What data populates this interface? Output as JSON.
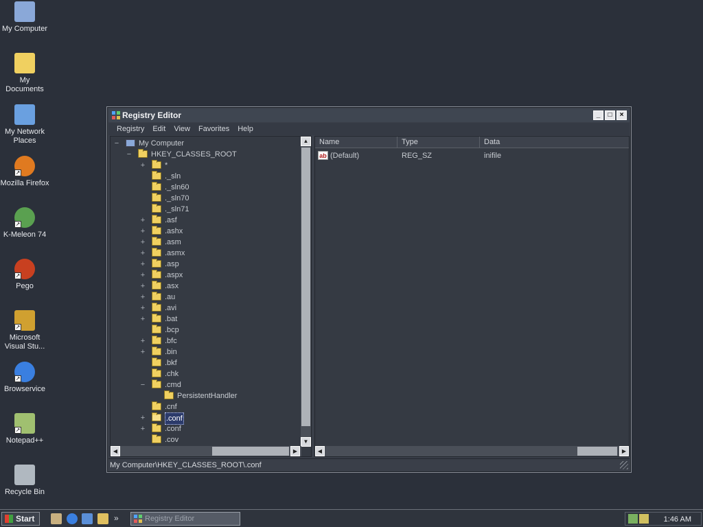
{
  "desktop": {
    "icons": [
      {
        "label": "My Computer",
        "icon": "computer-icon"
      },
      {
        "label": "My Documents",
        "icon": "documents-folder-icon"
      },
      {
        "label": "My Network Places",
        "icon": "network-icon"
      },
      {
        "label": "Mozilla Firefox",
        "icon": "firefox-icon"
      },
      {
        "label": "K-Meleon 74",
        "icon": "kmeleon-icon"
      },
      {
        "label": "Pego",
        "icon": "pego-icon"
      },
      {
        "label": "Microsoft Visual Stu...",
        "icon": "visual-studio-icon"
      },
      {
        "label": "Browservice",
        "icon": "ie-icon"
      },
      {
        "label": "Notepad++",
        "icon": "notepadpp-icon"
      },
      {
        "label": "Recycle Bin",
        "icon": "recycle-bin-icon"
      }
    ]
  },
  "window": {
    "title": "Registry Editor",
    "controls": {
      "minimize": "_",
      "maximize": "□",
      "close": "×"
    },
    "menu": [
      "Registry",
      "Edit",
      "View",
      "Favorites",
      "Help"
    ],
    "tree": [
      {
        "label": "My Computer",
        "expander": "−",
        "level": 0,
        "kind": "computer"
      },
      {
        "label": "HKEY_CLASSES_ROOT",
        "expander": "−",
        "level": 1,
        "kind": "folder"
      },
      {
        "label": "*",
        "expander": "+",
        "level": 2,
        "kind": "folder"
      },
      {
        "label": "._sln",
        "expander": "",
        "level": 2,
        "kind": "folder"
      },
      {
        "label": "._sln60",
        "expander": "",
        "level": 2,
        "kind": "folder"
      },
      {
        "label": "._sln70",
        "expander": "",
        "level": 2,
        "kind": "folder"
      },
      {
        "label": "._sln71",
        "expander": "",
        "level": 2,
        "kind": "folder"
      },
      {
        "label": ".asf",
        "expander": "+",
        "level": 2,
        "kind": "folder"
      },
      {
        "label": ".ashx",
        "expander": "+",
        "level": 2,
        "kind": "folder"
      },
      {
        "label": ".asm",
        "expander": "+",
        "level": 2,
        "kind": "folder"
      },
      {
        "label": ".asmx",
        "expander": "+",
        "level": 2,
        "kind": "folder"
      },
      {
        "label": ".asp",
        "expander": "+",
        "level": 2,
        "kind": "folder"
      },
      {
        "label": ".aspx",
        "expander": "+",
        "level": 2,
        "kind": "folder"
      },
      {
        "label": ".asx",
        "expander": "+",
        "level": 2,
        "kind": "folder"
      },
      {
        "label": ".au",
        "expander": "+",
        "level": 2,
        "kind": "folder"
      },
      {
        "label": ".avi",
        "expander": "+",
        "level": 2,
        "kind": "folder"
      },
      {
        "label": ".bat",
        "expander": "+",
        "level": 2,
        "kind": "folder"
      },
      {
        "label": ".bcp",
        "expander": "",
        "level": 2,
        "kind": "folder"
      },
      {
        "label": ".bfc",
        "expander": "+",
        "level": 2,
        "kind": "folder"
      },
      {
        "label": ".bin",
        "expander": "+",
        "level": 2,
        "kind": "folder"
      },
      {
        "label": ".bkf",
        "expander": "",
        "level": 2,
        "kind": "folder"
      },
      {
        "label": ".chk",
        "expander": "",
        "level": 2,
        "kind": "folder"
      },
      {
        "label": ".cmd",
        "expander": "−",
        "level": 2,
        "kind": "folder"
      },
      {
        "label": "PersistentHandler",
        "expander": "",
        "level": 3,
        "kind": "folder"
      },
      {
        "label": ".cnf",
        "expander": "",
        "level": 2,
        "kind": "folder"
      },
      {
        "label": ".conf",
        "expander": "+",
        "level": 2,
        "kind": "folder-open",
        "selected": true
      },
      {
        "label": ".conf",
        "expander": "+",
        "level": 2,
        "kind": "folder"
      },
      {
        "label": ".cov",
        "expander": "",
        "level": 2,
        "kind": "folder"
      }
    ],
    "list": {
      "columns": [
        "Name",
        "Type",
        "Data"
      ],
      "rows": [
        {
          "name": "(Default)",
          "type": "REG_SZ",
          "data": "inifile",
          "icon": "string-value-icon"
        }
      ]
    },
    "status": "My Computer\\HKEY_CLASSES_ROOT\\.conf"
  },
  "taskbar": {
    "start_label": "Start",
    "overflow": "»",
    "quicklaunch": [
      "show-desktop-icon",
      "ie-icon",
      "outlook-icon",
      "explorer-icon"
    ],
    "task_label": "Registry Editor",
    "clock": "1:46 AM"
  }
}
